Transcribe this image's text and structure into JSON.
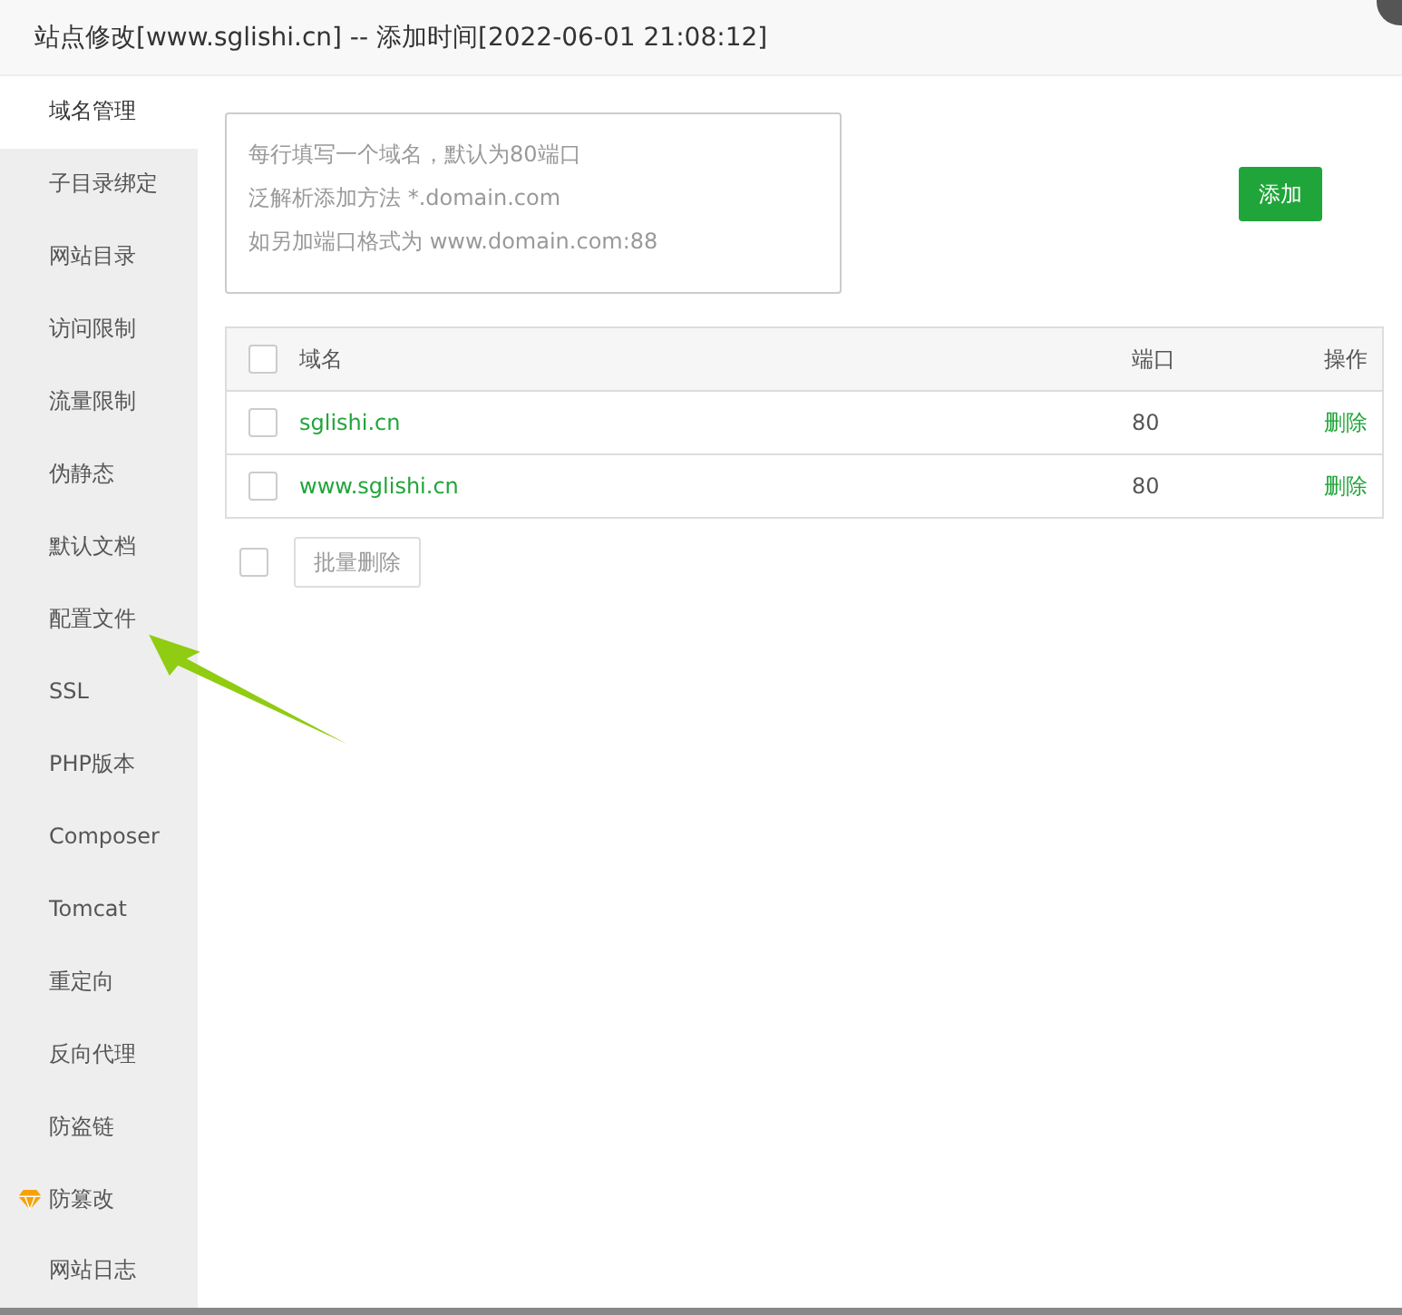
{
  "window": {
    "title": "站点修改[www.sglishi.cn] -- 添加时间[2022-06-01 21:08:12]"
  },
  "sidebar": {
    "items": [
      {
        "label": "域名管理",
        "selected": true,
        "kind": "plain"
      },
      {
        "label": "子目录绑定",
        "selected": false,
        "kind": "plain"
      },
      {
        "label": "网站目录",
        "selected": false,
        "kind": "plain"
      },
      {
        "label": "访问限制",
        "selected": false,
        "kind": "plain"
      },
      {
        "label": "流量限制",
        "selected": false,
        "kind": "plain"
      },
      {
        "label": "伪静态",
        "selected": false,
        "kind": "plain"
      },
      {
        "label": "默认文档",
        "selected": false,
        "kind": "plain"
      },
      {
        "label": "配置文件",
        "selected": false,
        "kind": "plain"
      },
      {
        "label": "SSL",
        "selected": false,
        "kind": "plain"
      },
      {
        "label": "PHP版本",
        "selected": false,
        "kind": "plain"
      },
      {
        "label": "Composer",
        "selected": false,
        "kind": "plain"
      },
      {
        "label": "Tomcat",
        "selected": false,
        "kind": "plain"
      },
      {
        "label": "重定向",
        "selected": false,
        "kind": "plain"
      },
      {
        "label": "反向代理",
        "selected": false,
        "kind": "plain"
      },
      {
        "label": "防盗链",
        "selected": false,
        "kind": "plain"
      },
      {
        "label": "防篡改",
        "selected": false,
        "kind": "pro"
      },
      {
        "label": "网站日志",
        "selected": false,
        "kind": "plain"
      }
    ]
  },
  "domain_input": {
    "placeholder_lines": [
      "每行填写一个域名，默认为80端口",
      "泛解析添加方法 *.domain.com",
      "如另加端口格式为 www.domain.com:88"
    ]
  },
  "add_button": "添加",
  "table": {
    "header_checked": false,
    "columns": [
      "域名",
      "端口",
      "操作"
    ],
    "rows": [
      {
        "checked": false,
        "domain": "sglishi.cn",
        "port": "80",
        "action": "删除"
      },
      {
        "checked": false,
        "domain": "www.sglishi.cn",
        "port": "80",
        "action": "删除"
      }
    ]
  },
  "bulk_delete": {
    "checked": false,
    "label": "批量删除"
  }
}
